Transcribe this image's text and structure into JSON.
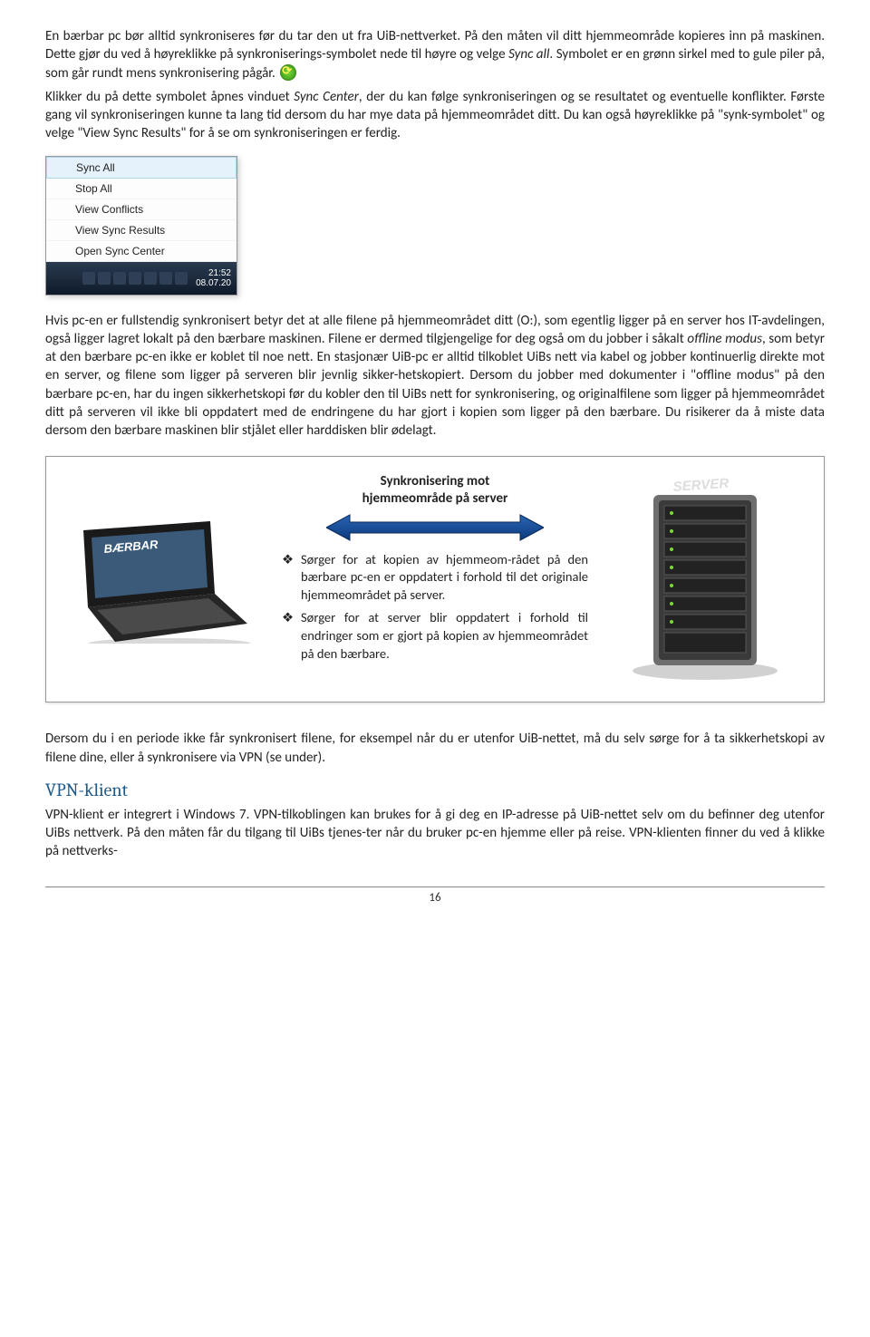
{
  "para1_a": "En bærbar pc bør alltid synkroniseres før du tar den ut fra UiB-nettverket. På den måten vil ditt hjemmeområde kopieres inn på maskinen. Dette gjør du ved å høyreklikke på synkroniserings-symbolet nede til høyre og velge ",
  "para1_i": "Sync all",
  "para1_b": ". Symbolet er en grønn sirkel med to gule piler på, som går rundt mens synkronisering pågår.",
  "para2_a": "Klikker du på dette symbolet åpnes vinduet ",
  "para2_i": "Sync Center",
  "para2_b": ", der du kan følge synkroniseringen og se resultatet og eventuelle konflikter. Første gang vil synkroniseringen kunne ta lang tid dersom du har mye data på hjemmeområdet ditt. Du kan også høyreklikke på \"synk-symbolet\" og velge \"View Sync Results\" for å se om synkroniseringen er ferdig.",
  "menu": {
    "items": [
      "Sync All",
      "Stop All",
      "View Conflicts",
      "View Sync Results",
      "Open Sync Center"
    ],
    "clock_time": "21:52",
    "clock_date": "08.07.20"
  },
  "para3_a": "Hvis pc-en er fullstendig synkronisert betyr det at alle filene på hjemmeområdet ditt (O:), som egentlig ligger på en server hos IT-avdelingen, også ligger lagret lokalt på den bærbare maskinen. Filene er dermed tilgjengelige for deg også om du jobber i såkalt ",
  "para3_i": "offline modus",
  "para3_b": ", som betyr at den bærbare pc-en ikke er koblet til noe nett. En stasjonær UiB-pc er alltid tilkoblet UiBs nett via kabel og jobber kontinuerlig direkte mot en server, og filene som ligger på serveren blir jevnlig sikker-hetskopiert. Dersom du jobber med dokumenter i \"offline modus\" på den bærbare pc-en, har du ingen sikkerhetskopi før du kobler den til UiBs nett for synkronisering, og originalfilene som ligger på hjemmeområdet ditt på serveren vil ikke bli oppdatert med de endringene du har gjort i kopien som ligger på den bærbare. Du risikerer da å miste data dersom den bærbare maskinen blir stjålet eller harddisken blir ødelagt.",
  "diagram": {
    "title_line1": "Synkronisering mot",
    "title_line2": "hjemmeområde på server",
    "laptop_label": "BÆRBAR",
    "server_label": "SERVER",
    "bullet1": "Sørger for at kopien av hjemmeom-rådet på den bærbare pc-en er oppdatert i forhold til det originale hjemmeområdet på server.",
    "bullet2": "Sørger for at server blir oppdatert i forhold til endringer som er gjort på kopien av hjemmeområdet på den bærbare."
  },
  "para4": "Dersom du i en periode ikke får synkronisert filene, for eksempel når du er utenfor UiB-nettet, må du selv sørge for å ta sikkerhetskopi av filene dine, eller å synkronisere via VPN (se under).",
  "heading": "VPN-klient",
  "para5": "VPN-klient er integrert i Windows 7. VPN-tilkoblingen kan brukes for å gi deg en IP-adresse på UiB-nettet selv om du befinner deg utenfor UiBs nettverk. På den måten får du tilgang til UiBs tjenes-ter når du bruker pc-en hjemme eller på reise. VPN-klienten finner du ved å klikke på nettverks-",
  "page_number": "16"
}
